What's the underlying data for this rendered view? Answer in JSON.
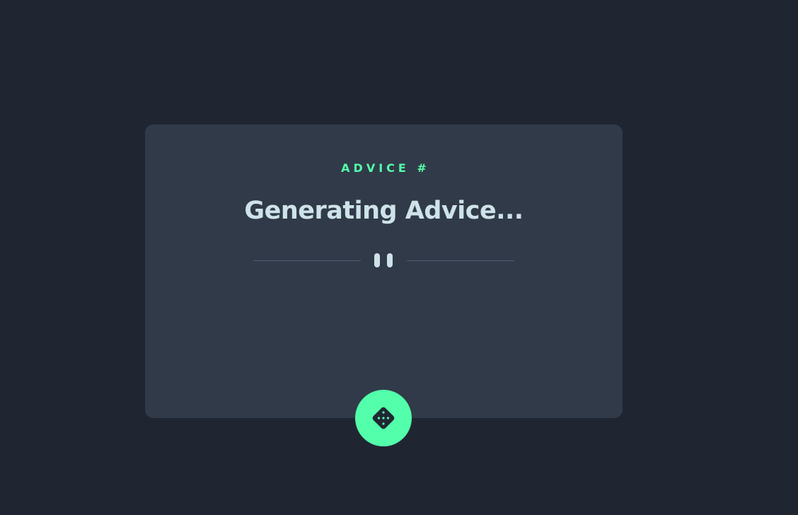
{
  "advice": {
    "label": "ADVICE #",
    "text": "Generating Advice..."
  },
  "divider": {
    "icon": "pause-icon"
  },
  "dice_button": {
    "icon": "dice-icon"
  },
  "colors": {
    "background": "#1f2632",
    "card": "#313a49",
    "accent": "#53ffaa",
    "text": "#cee3e9",
    "divider": "#4f5d74"
  }
}
